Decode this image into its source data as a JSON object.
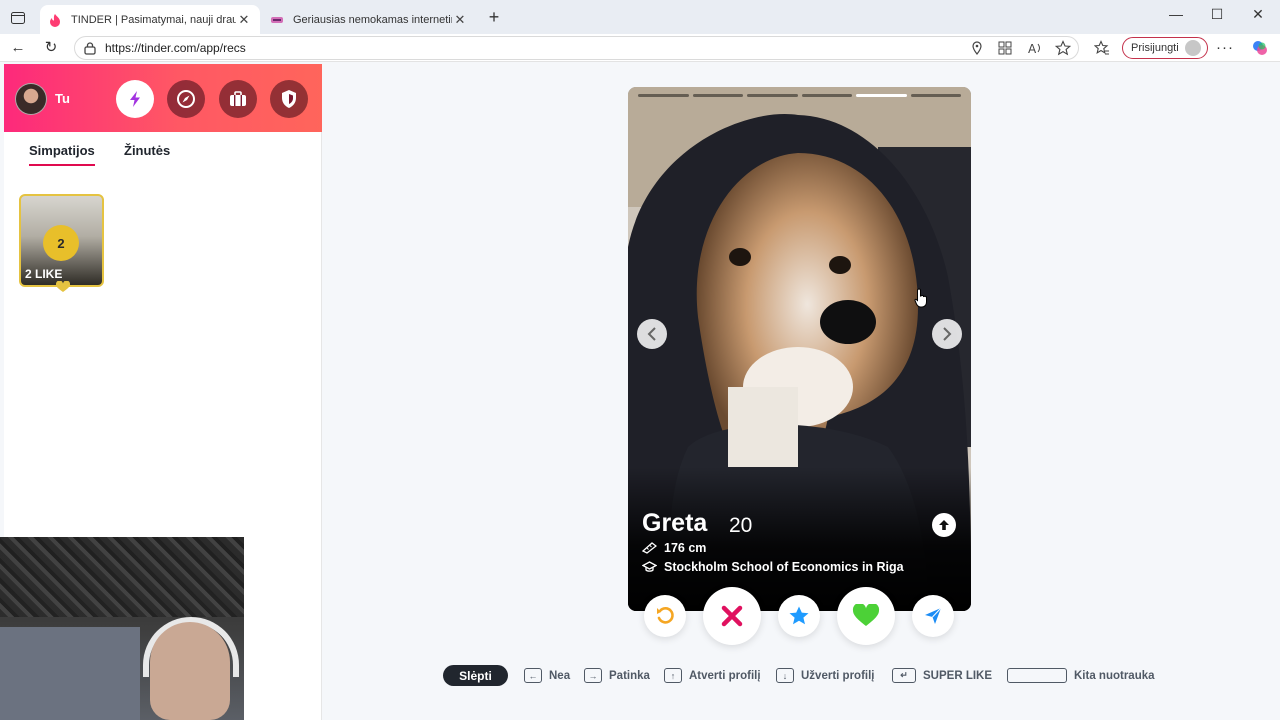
{
  "browser": {
    "tabs": [
      {
        "title": "TINDER | Pasimatymai, nauji draug",
        "active": true
      },
      {
        "title": "Geriausias nemokamas internetin",
        "active": false
      }
    ],
    "new_tab_label": "+",
    "address": "https://tinder.com/app/recs",
    "signin_label": "Prisijungti"
  },
  "sidebar": {
    "me_label": "Tu",
    "tabs": [
      {
        "label": "Simpatijos",
        "active": true
      },
      {
        "label": "Žinutės",
        "active": false
      }
    ],
    "likes": {
      "count": "2",
      "label": "2 LIKE"
    }
  },
  "profile": {
    "name": "Greta",
    "age": "20",
    "height": "176 cm",
    "school": "Stockholm School of Economics in Riga",
    "photo_count": 6,
    "active_photo": 5
  },
  "actions": [
    "rewind-button",
    "nope-button",
    "super-like-button",
    "like-button",
    "boost-button"
  ],
  "shortcuts": {
    "hide_label": "Slėpti",
    "items": [
      {
        "label": "Nea",
        "key": "←"
      },
      {
        "label": "Patinka",
        "key": "→"
      },
      {
        "label": "Atverti profilį",
        "key": "↑"
      },
      {
        "label": "Užverti profilį",
        "key": "↓"
      },
      {
        "label": "SUPER LIKE",
        "key": "↵"
      },
      {
        "label": "Kita nuotrauka",
        "key": "space"
      }
    ]
  },
  "colors": {
    "brand_gradient_start": "#fd297b",
    "brand_gradient_end": "#ff655b",
    "nope": "#e0115f",
    "super_like": "#1f9bff",
    "like": "#2bd964",
    "rewind": "#f5a623",
    "boost": "#1b8cf5"
  }
}
